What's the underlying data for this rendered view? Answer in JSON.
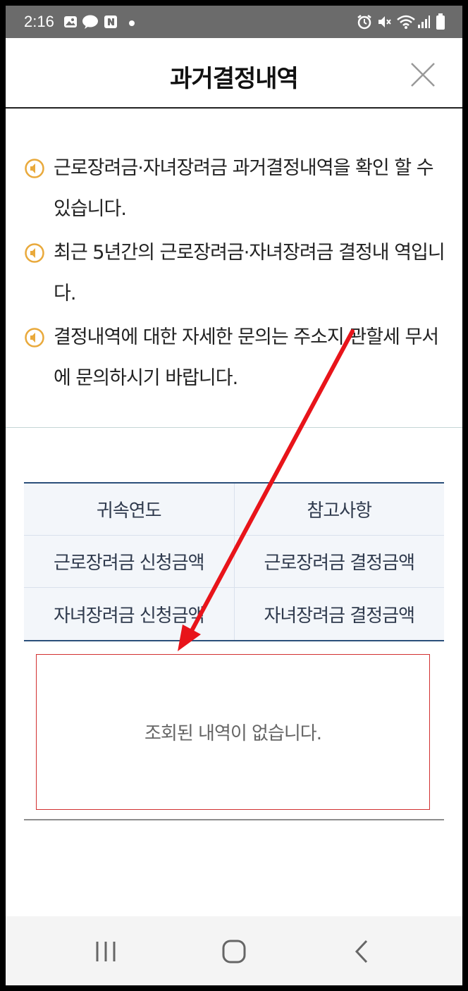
{
  "status_bar": {
    "time": "2:16"
  },
  "header": {
    "title": "과거결정내역"
  },
  "notices": [
    "근로장려금·자녀장려금 과거결정내역을 확인 할 수 있습니다.",
    "최근 5년간의 근로장려금·자녀장려금 결정내 역입니다.",
    "결정내역에 대한 자세한 문의는 주소지 관할세 무서에 문의하시기 바랍니다."
  ],
  "table": {
    "rows": [
      [
        "귀속연도",
        "참고사항"
      ],
      [
        "근로장려금 신청금액",
        "근로장려금 결정금액"
      ],
      [
        "자녀장려금 신청금액",
        "자녀장려금 결정금액"
      ]
    ]
  },
  "empty_message": "조회된 내역이 없습니다.",
  "colors": {
    "accent": "#e9a93b",
    "table_border": "#2b4f7a",
    "annotation": "#e8141a"
  }
}
